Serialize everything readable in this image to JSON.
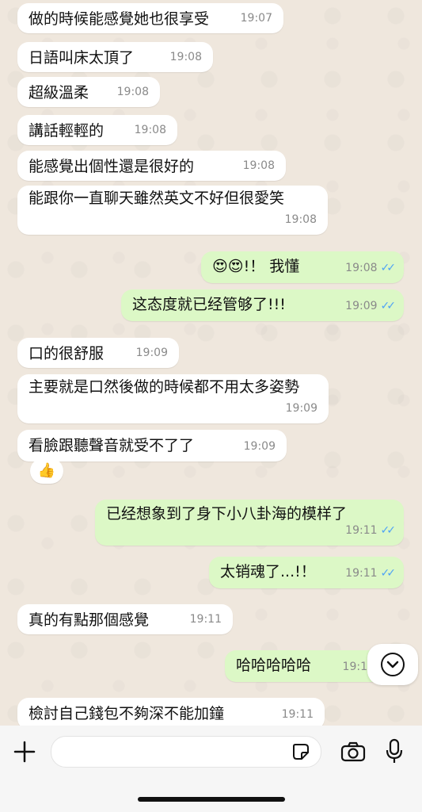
{
  "messages": [
    {
      "side": "in",
      "text": "做的時候能感覺她也很享受",
      "time": "19:07"
    },
    {
      "side": "in",
      "text": "日語叫床太頂了",
      "time": "19:08"
    },
    {
      "side": "in",
      "text": "超級溫柔",
      "time": "19:08"
    },
    {
      "side": "in",
      "text": "講話輕輕的",
      "time": "19:08"
    },
    {
      "side": "in",
      "text": "能感覺出個性還是很好的",
      "time": "19:08"
    },
    {
      "side": "in",
      "text": "能跟你一直聊天雖然英文不好但很愛笑",
      "time": "19:08"
    },
    {
      "side": "out",
      "text": "😍😍!！ 我懂",
      "time": "19:08"
    },
    {
      "side": "out",
      "text": "这态度就已经管够了!!!",
      "time": "19:09"
    },
    {
      "side": "in",
      "text": "口的很舒服",
      "time": "19:09"
    },
    {
      "side": "in",
      "text": "主要就是口然後做的時候都不用太多姿勢",
      "time": "19:09"
    },
    {
      "side": "in",
      "text": "看臉跟聽聲音就受不了了",
      "time": "19:09"
    },
    {
      "side": "out",
      "text": "已经想象到了身下小八卦海的模样了",
      "time": "19:11"
    },
    {
      "side": "out",
      "text": "太销魂了...!！",
      "time": "19:11"
    },
    {
      "side": "in",
      "text": "真的有點那個感覺",
      "time": "19:11"
    },
    {
      "side": "out",
      "text": "哈哈哈哈哈",
      "time": "19:1"
    },
    {
      "side": "in",
      "text": "檢討自己錢包不夠深不能加鐘",
      "time": "19:11"
    }
  ],
  "reaction": {
    "emoji": "👍"
  },
  "icons": {
    "plus": "plus-icon",
    "sticker": "sticker-icon",
    "camera": "camera-icon",
    "mic": "microphone-icon",
    "scroll": "chevron-down-icon",
    "tick": "double-check-icon"
  },
  "colors": {
    "incoming": "#ffffff",
    "outgoing": "#dcf8c6",
    "tick": "#4fa3f5"
  }
}
